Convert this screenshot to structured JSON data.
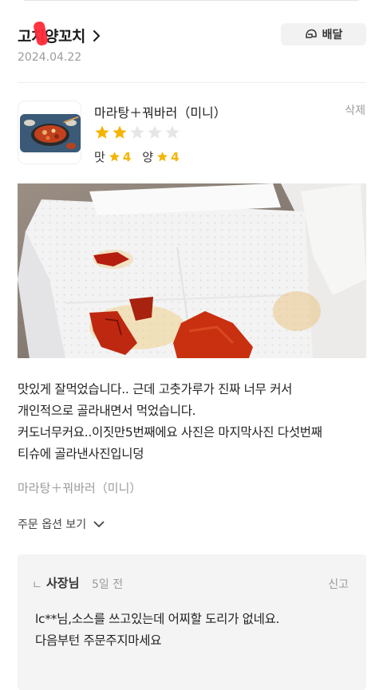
{
  "store": {
    "name": "고치양꼬치"
  },
  "delivery_button": {
    "label": "배달",
    "icon": "helmet-icon"
  },
  "review": {
    "date": "2024.04.22",
    "menu_name": "마라탕＋꿔바러（미니）",
    "delete_label": "삭제",
    "rating": 2,
    "max_rating": 5,
    "taste_label": "맛",
    "taste_score": "4",
    "amount_label": "양",
    "amount_score": "4",
    "text_lines": [
      "맛있게 잘먹었습니다.. 근데 고춧가루가 진짜 너무 커서",
      "개인적으로 골라내면서 먹었습니다.",
      "커도너무커요..이짓만5번째에요 사진은 마지막사진 다섯번째",
      "티슈에 골라낸사진입니덩"
    ],
    "ordered_menu": "마라탕＋꿔바러（미니）",
    "order_options_label": "주문 옵션 보기"
  },
  "owner_reply": {
    "arrow": "ㄴ",
    "author": "사장님",
    "time": "5일 전",
    "report_label": "신고",
    "text_lines": [
      "lc**님,소스를 쓰고있는데 어찌할 도리가 없네요.",
      "다음부턴 주문주지마세요"
    ]
  },
  "colors": {
    "star_filled": "#f5b400",
    "star_empty": "#e6e6e6",
    "muted_text": "#9b9b9b",
    "reply_bg": "#f4f4f5",
    "redaction": "#ff2a3a"
  }
}
